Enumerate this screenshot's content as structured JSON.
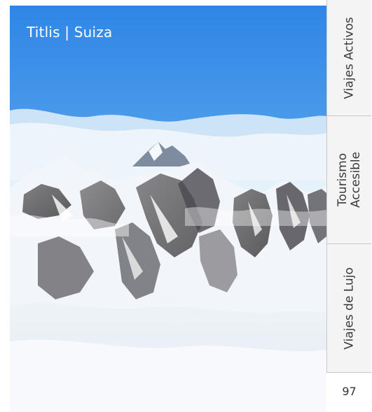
{
  "photo": {
    "caption": "Titlis | Suiza",
    "icon": "mountain-landscape-photo"
  },
  "tabs": [
    {
      "label_lines": [
        "Viajes Activos"
      ]
    },
    {
      "label_lines": [
        "Tourismo",
        "Accesible"
      ]
    },
    {
      "label_lines": [
        "Viajes de Lujo"
      ]
    }
  ],
  "page_number": "97",
  "colors": {
    "sky_top": "#2f86e6",
    "sky_bottom": "#a9d2f2",
    "snow": "#f3f6fa",
    "rock": "#5b5a5c",
    "tab_background": "#f4f4f4",
    "tab_border": "#c9c9c9",
    "text_dark": "#3a3a3a"
  }
}
